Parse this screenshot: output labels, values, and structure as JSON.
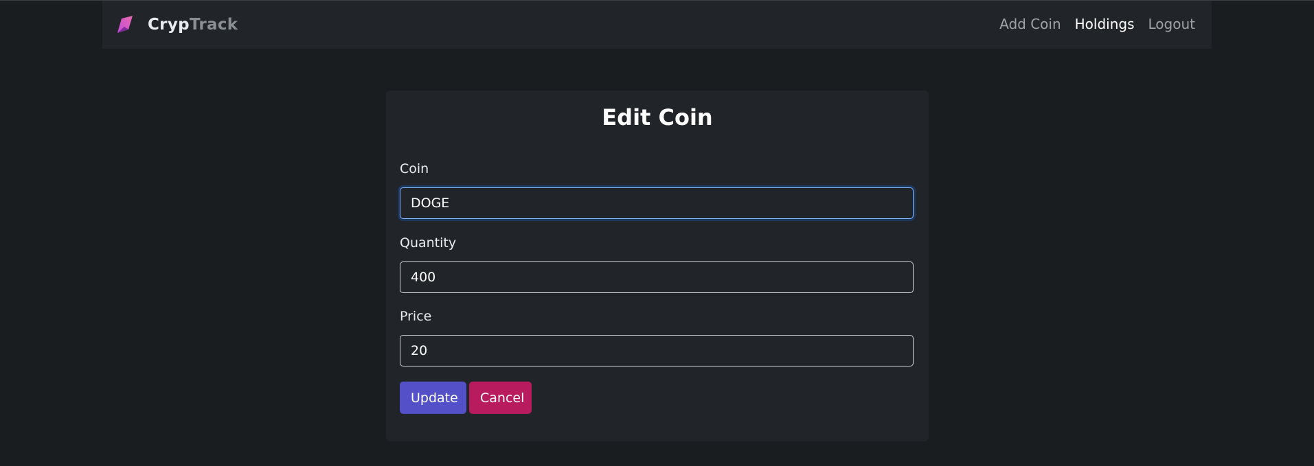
{
  "app": {
    "brand_part1": "Cryp",
    "brand_part2": "Track",
    "logo_icon": "crystal-feather-icon"
  },
  "nav": {
    "items": [
      {
        "label": "Add Coin",
        "active": false
      },
      {
        "label": "Holdings",
        "active": true
      },
      {
        "label": "Logout",
        "active": false
      }
    ]
  },
  "form": {
    "title": "Edit Coin",
    "coin_label": "Coin",
    "coin_value": "DOGE",
    "quantity_label": "Quantity",
    "quantity_value": "400",
    "price_label": "Price",
    "price_value": "20",
    "update_label": "Update",
    "cancel_label": "Cancel"
  },
  "colors": {
    "background": "#1a1d20",
    "surface": "#212529",
    "primary": "#5350c8",
    "danger": "#b81b5e",
    "focus": "#86b7fe"
  }
}
